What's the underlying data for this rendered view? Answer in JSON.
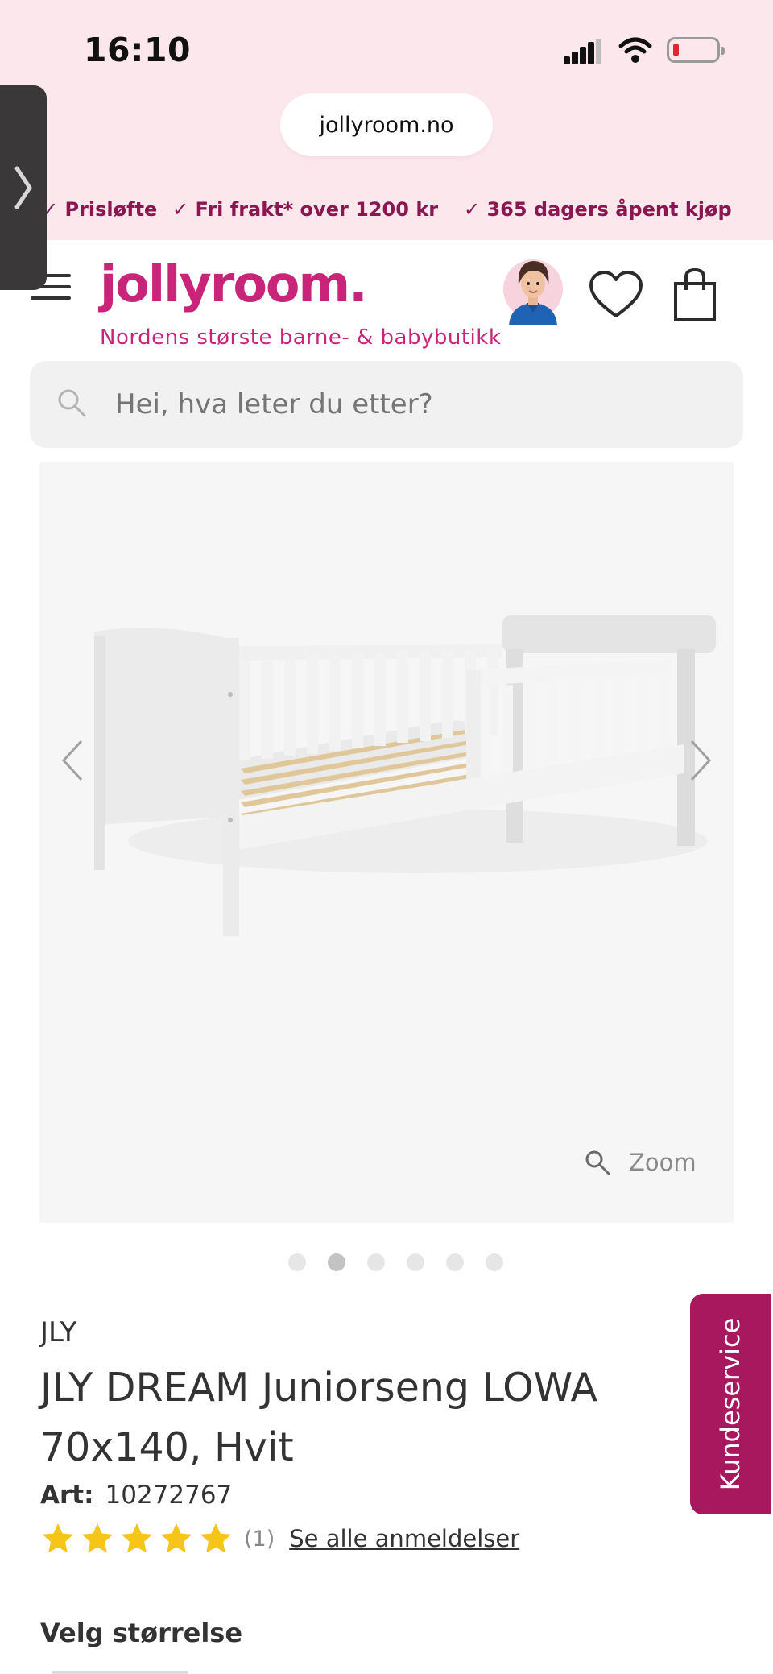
{
  "status_bar": {
    "time": "16:10"
  },
  "browser": {
    "url": "jollyroom.no"
  },
  "usp": [
    {
      "check": "✓",
      "label": "Prisløfte"
    },
    {
      "check": "✓",
      "label": "Fri frakt* over 1200 kr"
    },
    {
      "check": "✓",
      "label": "365 dagers åpent kjøp"
    }
  ],
  "header": {
    "logo_text": "jollyroom.",
    "tagline": "Nordens største barne- & babybutikk"
  },
  "search": {
    "placeholder": "Hei, hva leter du etter?"
  },
  "gallery": {
    "zoom_label": "Zoom",
    "image_count": 6,
    "active_index": 1
  },
  "product": {
    "brand": "JLY",
    "title": "JLY DREAM Juniorseng LOWA 70x140, Hvit",
    "art_label": "Art:",
    "art_number": "10272767",
    "rating_stars": 5,
    "review_count": "(1)",
    "reviews_link": "Se alle anmeldelser",
    "size_label": "Velg størrelse"
  },
  "customer_service": {
    "label": "Kundeservice"
  },
  "colors": {
    "brand_pink": "#c8257a",
    "usp_text": "#8a1752",
    "kundeservice_bg": "#a8185e",
    "star": "#f5c518"
  }
}
